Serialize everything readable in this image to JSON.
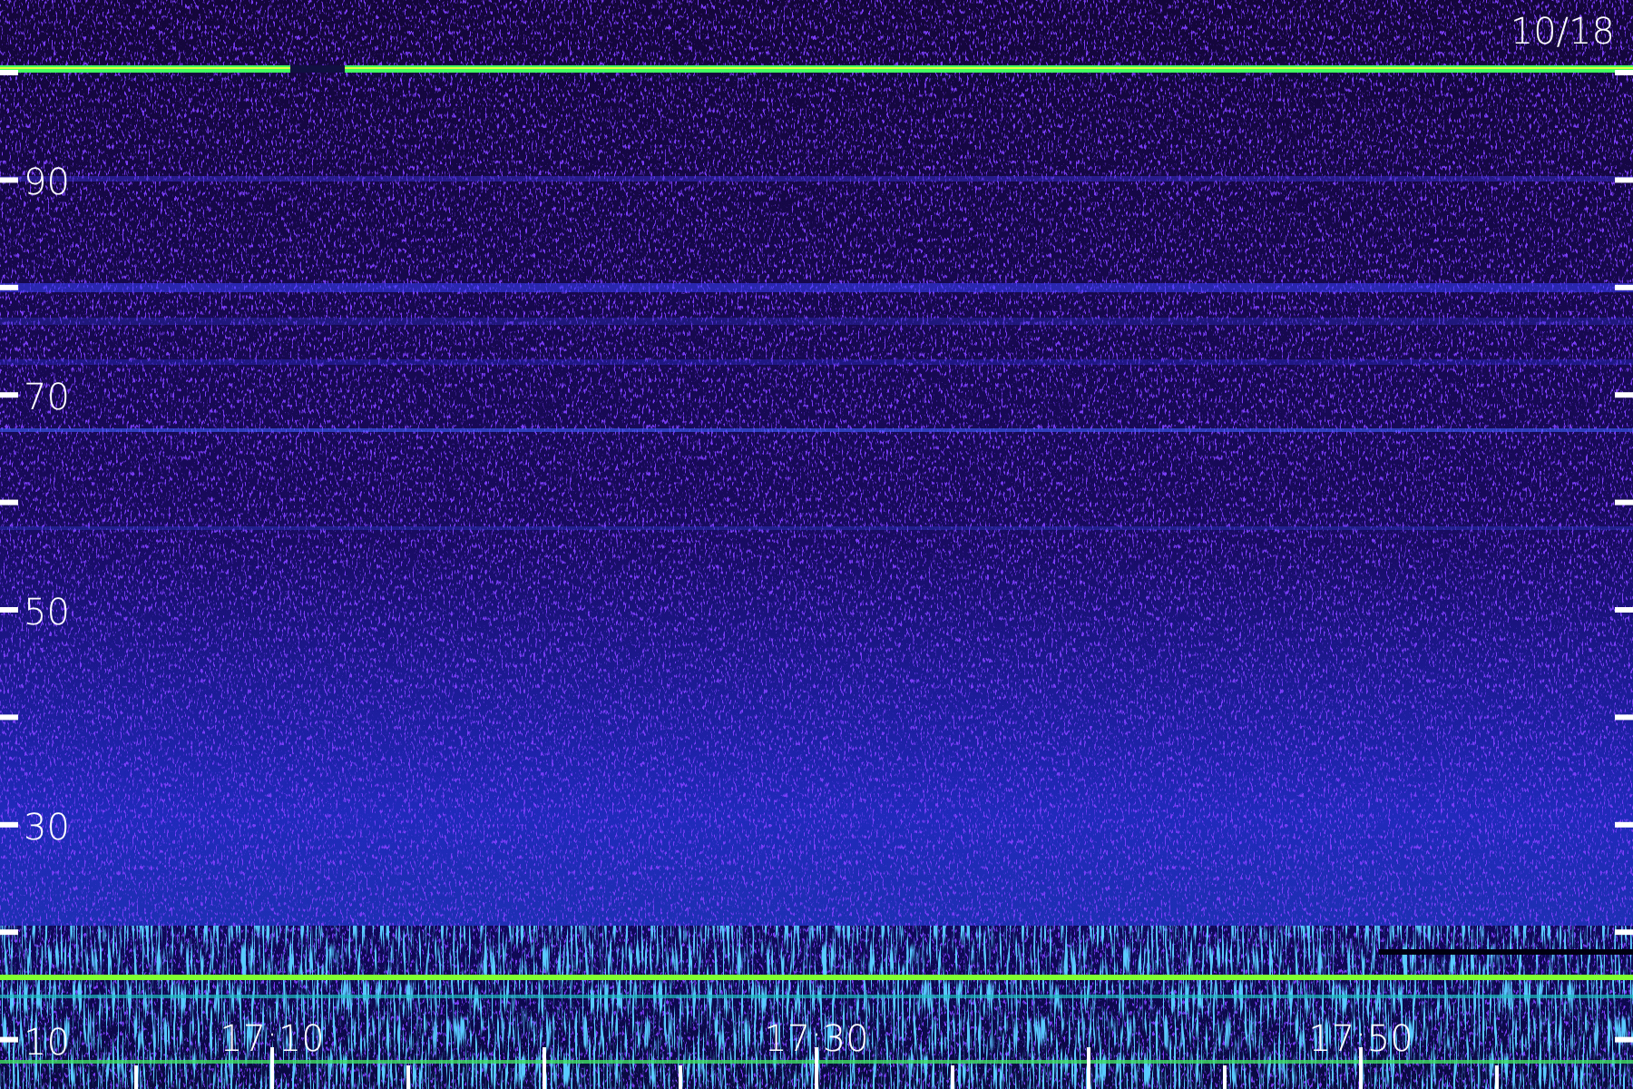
{
  "date_label": "10/18",
  "y_axis_labels": [
    "90",
    "70",
    "50",
    "30",
    "10"
  ],
  "x_axis_labels": [
    "17:10",
    "17:30",
    "17:50"
  ]
}
